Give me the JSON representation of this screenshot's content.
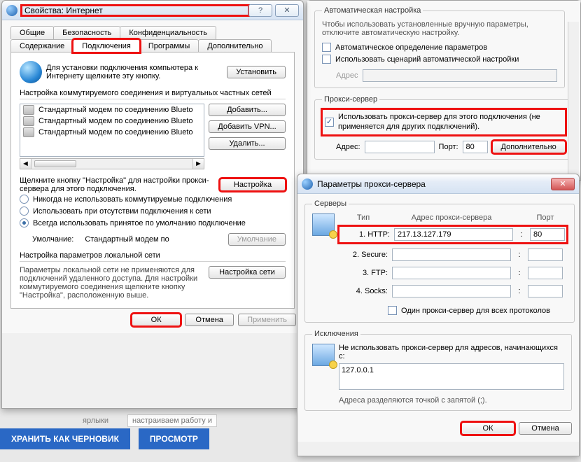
{
  "win1": {
    "title": "Свойства: Интернет",
    "help": "?",
    "close": "✕",
    "tabs_row1": [
      "Общие",
      "Безопасность",
      "Конфиденциальность"
    ],
    "tabs_row2": [
      "Содержание",
      "Подключения",
      "Программы",
      "Дополнительно"
    ],
    "install_text": "Для установки подключения компьютера к Интернету щелкните эту кнопку.",
    "install_btn": "Установить",
    "dialup_title": "Настройка коммутируемого соединения и виртуальных частных сетей",
    "modems": [
      "Стандартный модем по соединению Blueto",
      "Стандартный модем по соединению Blueto",
      "Стандартный модем по соединению Blueto"
    ],
    "add_btn": "Добавить...",
    "add_vpn_btn": "Добавить VPN...",
    "delete_btn": "Удалить...",
    "settings_hint": "Щелкните кнопку \"Настройка\" для настройки прокси-сервера для этого подключения.",
    "settings_btn": "Настройка",
    "radio_never": "Никогда не использовать коммутируемые подключения",
    "radio_none": "Использовать при отсутствии подключения к сети",
    "radio_always": "Всегда использовать принятое по умолчанию подключение",
    "default_label": "Умолчание:",
    "default_value": "Стандартный модем по",
    "default_btn": "Умолчание",
    "lan_title": "Настройка параметров локальной сети",
    "lan_text": "Параметры локальной сети не применяются для подключений удаленного доступа. Для настройки коммутируемого соединения щелкните кнопку \"Настройка\", расположенную выше.",
    "lan_btn": "Настройка сети",
    "ok": "ОК",
    "cancel": "Отмена",
    "apply": "Применить"
  },
  "panel2": {
    "auto_title": "Автоматическая настройка",
    "auto_hint": "Чтобы использовать установленные вручную параметры, отключите автоматическую настройку.",
    "auto_detect": "Автоматическое определение параметров",
    "auto_script": "Использовать сценарий автоматической настройки",
    "address_label": "Адрес",
    "proxy_title": "Прокси-сервер",
    "proxy_use": "Использовать прокси-сервер для этого подключения (не применяется для других подключений).",
    "addr_label": "Адрес:",
    "port_label": "Порт:",
    "port_value": "80",
    "more_btn": "Дополнительно"
  },
  "win3": {
    "title": "Параметры прокси-сервера",
    "close": "✕",
    "servers_title": "Серверы",
    "col_type": "Тип",
    "col_addr": "Адрес прокси-сервера",
    "col_port": "Порт",
    "rows": [
      {
        "label": "1. HTTP:",
        "addr": "217.13.127.179",
        "port": "80"
      },
      {
        "label": "2. Secure:",
        "addr": "",
        "port": ""
      },
      {
        "label": "3. FTP:",
        "addr": "",
        "port": ""
      },
      {
        "label": "4. Socks:",
        "addr": "",
        "port": ""
      }
    ],
    "same_all": "Один прокси-сервер для всех протоколов",
    "excl_title": "Исключения",
    "excl_hint": "Не использовать прокси-сервер для адресов, начинающихся с:",
    "excl_value": "127.0.0.1",
    "excl_note": "Адреса разделяются точкой с запятой (;).",
    "ok": "ОК",
    "cancel": "Отмена"
  },
  "bottom": {
    "save_draft": "ХРАНИТЬ КАК ЧЕРНОВИК",
    "preview": "ПРОСМОТР",
    "bg1": "ярлыки",
    "bg2": "настраиваем работу и"
  }
}
